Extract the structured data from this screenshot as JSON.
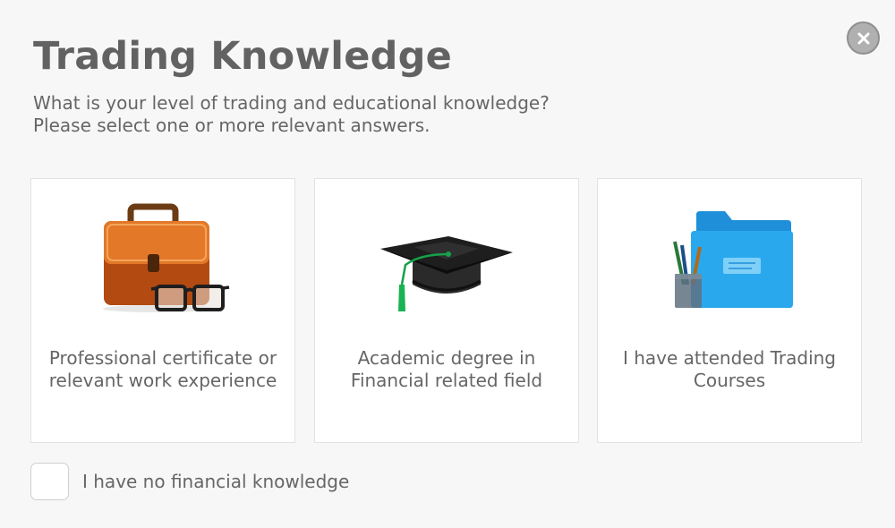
{
  "dialog": {
    "title": "Trading Knowledge",
    "subtitle_line1": "What is your level of trading and educational knowledge?",
    "subtitle_line2": "Please select one or more relevant answers.",
    "close_icon": "close-icon"
  },
  "options": [
    {
      "icon": "briefcase-glasses-icon",
      "line1": "Professional certificate or",
      "line2": "relevant work experience"
    },
    {
      "icon": "graduation-cap-icon",
      "line1": "Academic degree in",
      "line2": "Financial related field"
    },
    {
      "icon": "folder-pens-icon",
      "line1": "I have attended Trading",
      "line2": "Courses"
    }
  ],
  "no_knowledge": {
    "label": "I have no financial knowledge",
    "checked": false
  },
  "colors": {
    "background": "#f7f7f7",
    "text": "#666666",
    "close_button": "#b0b0b0"
  }
}
